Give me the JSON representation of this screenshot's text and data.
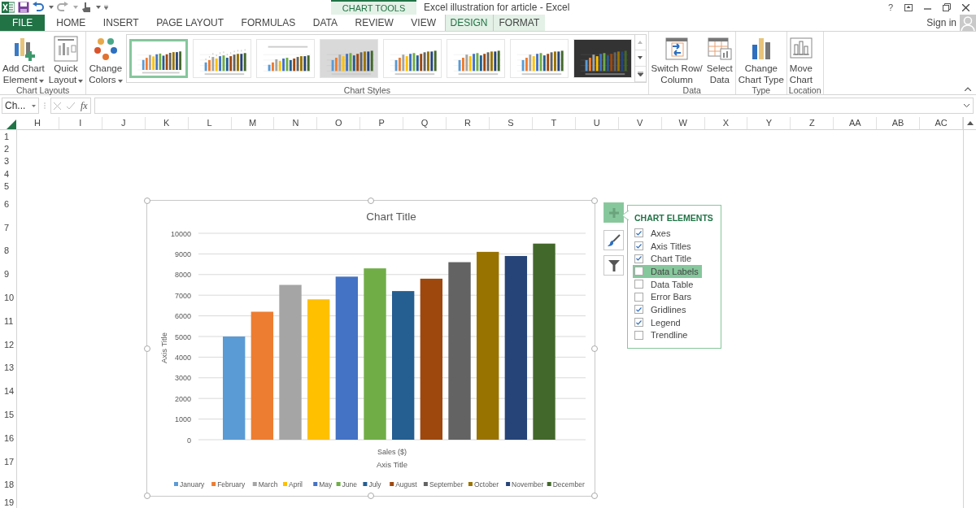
{
  "title_bar": {
    "contextual_label": "CHART TOOLS",
    "title": "Excel illustration for article - Excel",
    "help": "?"
  },
  "tabs": [
    {
      "label": "FILE",
      "kind": "file",
      "selected": false
    },
    {
      "label": "HOME",
      "kind": "normal",
      "selected": false
    },
    {
      "label": "INSERT",
      "kind": "normal",
      "selected": false
    },
    {
      "label": "PAGE LAYOUT",
      "kind": "normal",
      "selected": false
    },
    {
      "label": "FORMULAS",
      "kind": "normal",
      "selected": false
    },
    {
      "label": "DATA",
      "kind": "normal",
      "selected": false
    },
    {
      "label": "REVIEW",
      "kind": "normal",
      "selected": false
    },
    {
      "label": "VIEW",
      "kind": "normal",
      "selected": false
    },
    {
      "label": "DESIGN",
      "kind": "contextual",
      "selected": true
    },
    {
      "label": "FORMAT",
      "kind": "contextual",
      "selected": false
    }
  ],
  "account": {
    "label": "Sign in"
  },
  "ribbon": {
    "groups": [
      {
        "label": "Chart Layouts",
        "items": [
          {
            "kind": "button",
            "lines": [
              "Add Chart",
              "Element"
            ],
            "dropdown": true
          },
          {
            "kind": "button",
            "lines": [
              "Quick",
              "Layout"
            ],
            "dropdown": true
          }
        ]
      },
      {
        "label": "Chart Styles",
        "items": [
          {
            "kind": "button",
            "lines": [
              "Change",
              "Colors"
            ],
            "dropdown": true
          },
          {
            "kind": "gallery",
            "styles": [
              {
                "kind": "plain",
                "selected": true
              },
              {
                "kind": "labeled",
                "selected": false
              },
              {
                "kind": "legend-top",
                "selected": false
              },
              {
                "kind": "shaded",
                "selected": false
              },
              {
                "kind": "plain",
                "selected": false
              },
              {
                "kind": "plain",
                "selected": false
              },
              {
                "kind": "plain",
                "selected": false
              },
              {
                "kind": "dark",
                "selected": false
              }
            ]
          }
        ]
      },
      {
        "label": "Data",
        "items": [
          {
            "kind": "button",
            "lines": [
              "Switch Row/",
              "Column"
            ],
            "dropdown": false
          },
          {
            "kind": "button",
            "lines": [
              "Select",
              "Data"
            ],
            "dropdown": false
          }
        ]
      },
      {
        "label": "Type",
        "items": [
          {
            "kind": "button",
            "lines": [
              "Change",
              "Chart Type"
            ],
            "dropdown": false
          }
        ]
      },
      {
        "label": "Location",
        "items": [
          {
            "kind": "button",
            "lines": [
              "Move",
              "Chart"
            ],
            "dropdown": false
          }
        ]
      }
    ]
  },
  "formula_bar": {
    "name_box": "Ch...",
    "function_label": "fx"
  },
  "sheet": {
    "columns": [
      "H",
      "I",
      "J",
      "K",
      "L",
      "M",
      "N",
      "O",
      "P",
      "Q",
      "R",
      "S",
      "T",
      "U",
      "V",
      "W",
      "X",
      "Y",
      "Z",
      "AA",
      "AB",
      "AC"
    ],
    "rows": [
      {
        "label": "1",
        "kind": "short"
      },
      {
        "label": "2",
        "kind": "short"
      },
      {
        "label": "3",
        "kind": "short"
      },
      {
        "label": "4",
        "kind": "short"
      },
      {
        "label": "5",
        "kind": "short"
      },
      {
        "label": "6",
        "kind": "tall"
      },
      {
        "label": "7",
        "kind": "tall"
      },
      {
        "label": "8",
        "kind": "tall"
      },
      {
        "label": "9",
        "kind": "tall"
      },
      {
        "label": "10",
        "kind": "tall"
      },
      {
        "label": "11",
        "kind": "tall"
      },
      {
        "label": "12",
        "kind": "tall"
      },
      {
        "label": "13",
        "kind": "tall"
      },
      {
        "label": "14",
        "kind": "tall"
      },
      {
        "label": "15",
        "kind": "tall"
      },
      {
        "label": "16",
        "kind": "tall"
      },
      {
        "label": "17",
        "kind": "tall"
      },
      {
        "label": "18",
        "kind": "tall"
      },
      {
        "label": "19",
        "kind": "short"
      }
    ]
  },
  "chart": {
    "chart_data": {
      "type": "bar",
      "title": "Chart Title",
      "xlabel": "Axis Title",
      "ylabel": "Axis Title",
      "categories": [
        "Sales ($)"
      ],
      "series": [
        {
          "name": "January",
          "color": "#5b9bd5",
          "values": [
            5000
          ]
        },
        {
          "name": "February",
          "color": "#ed7d31",
          "values": [
            6200
          ]
        },
        {
          "name": "March",
          "color": "#a5a5a5",
          "values": [
            7500
          ]
        },
        {
          "name": "April",
          "color": "#ffc000",
          "values": [
            6800
          ]
        },
        {
          "name": "May",
          "color": "#4472c4",
          "values": [
            7900
          ]
        },
        {
          "name": "June",
          "color": "#70ad47",
          "values": [
            8300
          ]
        },
        {
          "name": "July",
          "color": "#255e91",
          "values": [
            7200
          ]
        },
        {
          "name": "August",
          "color": "#9e480e",
          "values": [
            7800
          ]
        },
        {
          "name": "September",
          "color": "#636363",
          "values": [
            8600
          ]
        },
        {
          "name": "October",
          "color": "#997300",
          "values": [
            9100
          ]
        },
        {
          "name": "November",
          "color": "#264478",
          "values": [
            8900
          ]
        },
        {
          "name": "December",
          "color": "#43682b",
          "values": [
            9500
          ]
        }
      ],
      "grid": true,
      "legend": true,
      "ylim": [
        0,
        10000
      ],
      "yticks": [
        0,
        1000,
        2000,
        3000,
        4000,
        5000,
        6000,
        7000,
        8000,
        9000,
        10000
      ]
    }
  },
  "chart_buttons": [
    {
      "selected": true
    },
    {
      "selected": false
    },
    {
      "selected": false
    }
  ],
  "chart_elements": {
    "title": "CHART ELEMENTS",
    "items": [
      {
        "label": "Axes",
        "checked": true,
        "highlighted": false
      },
      {
        "label": "Axis Titles",
        "checked": true,
        "highlighted": false
      },
      {
        "label": "Chart Title",
        "checked": true,
        "highlighted": false
      },
      {
        "label": "Data Labels",
        "checked": false,
        "highlighted": true
      },
      {
        "label": "Data Table",
        "checked": false,
        "highlighted": false
      },
      {
        "label": "Error Bars",
        "checked": false,
        "highlighted": false
      },
      {
        "label": "Gridlines",
        "checked": true,
        "highlighted": false
      },
      {
        "label": "Legend",
        "checked": true,
        "highlighted": false
      },
      {
        "label": "Trendline",
        "checked": false,
        "highlighted": false
      }
    ]
  }
}
